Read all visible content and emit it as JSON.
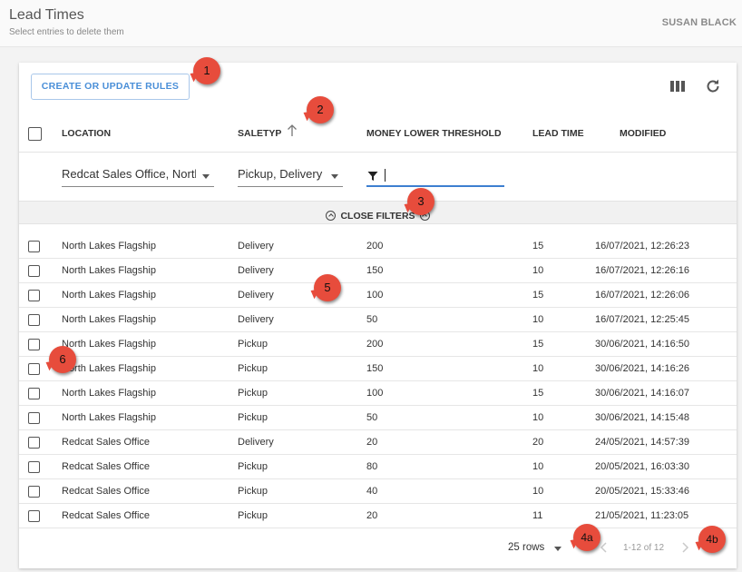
{
  "header": {
    "title": "Lead Times",
    "subtitle": "Select entries to delete them",
    "user": "SUSAN BLACK"
  },
  "toolbar": {
    "rules_button": "CREATE OR UPDATE RULES",
    "columns_icon": "view-column-icon",
    "refresh_icon": "refresh-icon"
  },
  "columns": [
    "LOCATION",
    "SALETYP",
    "MONEY LOWER THRESHOLD",
    "LEAD TIME",
    "MODIFIED"
  ],
  "sort_icon": "arrow-up-icon",
  "filters": {
    "location_value": "Redcat Sales Office, North Lakes Flagship",
    "saletype_value": "Pickup, Delivery",
    "threshold_value": "",
    "close_label": "CLOSE FILTERS"
  },
  "rows": [
    {
      "location": "North Lakes Flagship",
      "saletype": "Delivery",
      "threshold": "200",
      "lead_time": "15",
      "modified": "16/07/2021, 12:26:23"
    },
    {
      "location": "North Lakes Flagship",
      "saletype": "Delivery",
      "threshold": "150",
      "lead_time": "10",
      "modified": "16/07/2021, 12:26:16"
    },
    {
      "location": "North Lakes Flagship",
      "saletype": "Delivery",
      "threshold": "100",
      "lead_time": "15",
      "modified": "16/07/2021, 12:26:06"
    },
    {
      "location": "North Lakes Flagship",
      "saletype": "Delivery",
      "threshold": "50",
      "lead_time": "10",
      "modified": "16/07/2021, 12:25:45"
    },
    {
      "location": "North Lakes Flagship",
      "saletype": "Pickup",
      "threshold": "200",
      "lead_time": "15",
      "modified": "30/06/2021, 14:16:50"
    },
    {
      "location": "North Lakes Flagship",
      "saletype": "Pickup",
      "threshold": "150",
      "lead_time": "10",
      "modified": "30/06/2021, 14:16:26"
    },
    {
      "location": "North Lakes Flagship",
      "saletype": "Pickup",
      "threshold": "100",
      "lead_time": "15",
      "modified": "30/06/2021, 14:16:07"
    },
    {
      "location": "North Lakes Flagship",
      "saletype": "Pickup",
      "threshold": "50",
      "lead_time": "10",
      "modified": "30/06/2021, 14:15:48"
    },
    {
      "location": "Redcat Sales Office",
      "saletype": "Delivery",
      "threshold": "20",
      "lead_time": "20",
      "modified": "24/05/2021, 14:57:39"
    },
    {
      "location": "Redcat Sales Office",
      "saletype": "Pickup",
      "threshold": "80",
      "lead_time": "10",
      "modified": "20/05/2021, 16:03:30"
    },
    {
      "location": "Redcat Sales Office",
      "saletype": "Pickup",
      "threshold": "40",
      "lead_time": "10",
      "modified": "20/05/2021, 15:33:46"
    },
    {
      "location": "Redcat Sales Office",
      "saletype": "Pickup",
      "threshold": "20",
      "lead_time": "11",
      "modified": "21/05/2021, 11:23:05"
    }
  ],
  "pagination": {
    "rows_per_page": "25 rows",
    "range": "1-12 of 12"
  },
  "callouts": [
    "1",
    "2",
    "3",
    "4a",
    "4b",
    "5",
    "6"
  ],
  "colors": {
    "accent": "#4a8fd8",
    "callout": "#e74c3c"
  }
}
